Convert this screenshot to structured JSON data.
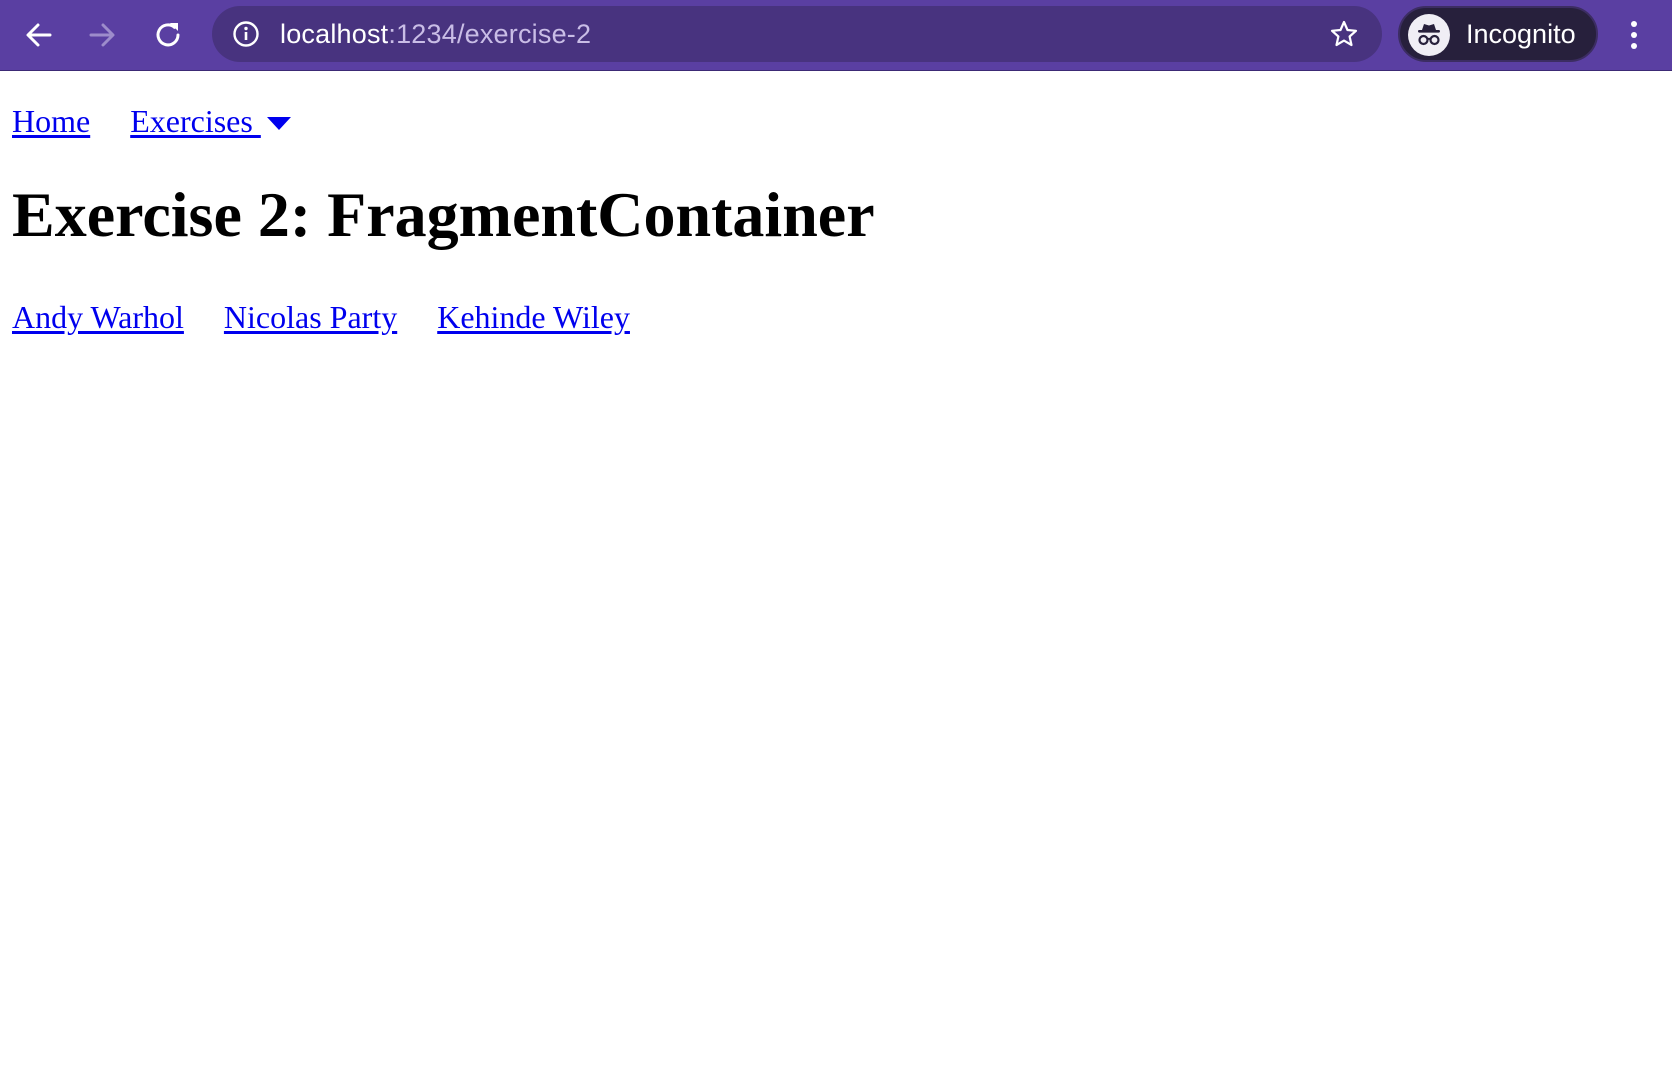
{
  "browser": {
    "url_host": "localhost",
    "url_path": ":1234/exercise-2",
    "profile_label": "Incognito",
    "icons": {
      "back": "arrow-left-icon",
      "forward": "arrow-right-icon",
      "reload": "reload-icon",
      "info": "info-icon",
      "bookmark": "star-icon",
      "profile": "incognito-icon",
      "menu": "kebab-menu-icon"
    },
    "colors": {
      "toolbar": "#5a3fa2",
      "omnibox": "#48337f",
      "profile_pill": "#27203c"
    }
  },
  "nav": {
    "home_label": "Home",
    "exercises_label": "Exercises "
  },
  "page": {
    "title": "Exercise 2: FragmentContainer",
    "artists": [
      {
        "label": "Andy Warhol"
      },
      {
        "label": "Nicolas Party"
      },
      {
        "label": "Kehinde Wiley"
      }
    ],
    "link_color": "#0000ee"
  }
}
